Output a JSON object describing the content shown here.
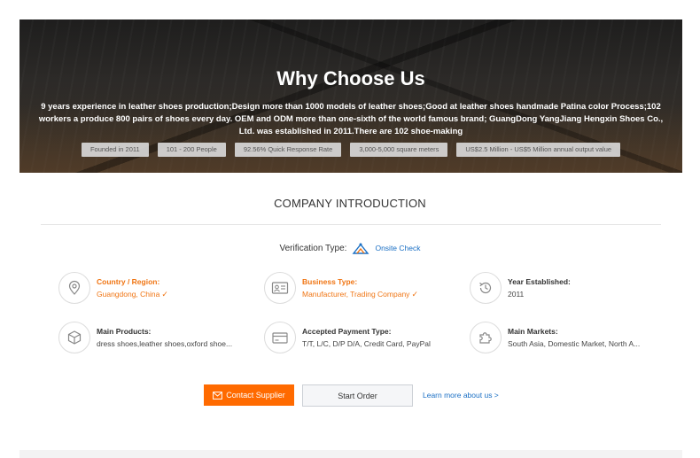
{
  "hero": {
    "title": "Why Choose Us",
    "description": "9 years experience in leather shoes production;Design more than 1000 models of leather shoes;Good at leather shoes handmade Patina color Process;102 workers a produce 800 pairs of shoes every day. OEM and ODM more than one-sixth of the world famous brand; GuangDong YangJiang Hengxin Shoes Co., Ltd. was established in 2011.There are 102 shoe-making",
    "tags": [
      "Founded in 2011",
      "101 - 200 People",
      "92.56% Quick Response Rate",
      "3,000-5,000 square meters",
      "US$2.5 Million - US$5 Million annual output value"
    ]
  },
  "intro": {
    "title": "COMPANY INTRODUCTION",
    "verification_label": "Verification Type:",
    "verification_value": "Onsite Check"
  },
  "info": {
    "country_label": "Country / Region:",
    "country_value": "Guangdong, China",
    "business_label": "Business Type:",
    "business_value": "Manufacturer, Trading Company",
    "year_label": "Year Established:",
    "year_value": "2011",
    "products_label": "Main Products:",
    "products_value": "dress shoes,leather shoes,oxford shoe...",
    "payment_label": "Accepted Payment Type:",
    "payment_value": "T/T, L/C, D/P D/A, Credit Card, PayPal",
    "markets_label": "Main Markets:",
    "markets_value": "South Asia, Domestic Market, North A..."
  },
  "actions": {
    "contact_label": "Contact Supplier",
    "order_label": "Start Order",
    "learn_more_label": "Learn more about us >"
  },
  "colors": {
    "accent_orange": "#ff6a00",
    "label_orange": "#f07513",
    "link_blue": "#1a6fc4"
  }
}
